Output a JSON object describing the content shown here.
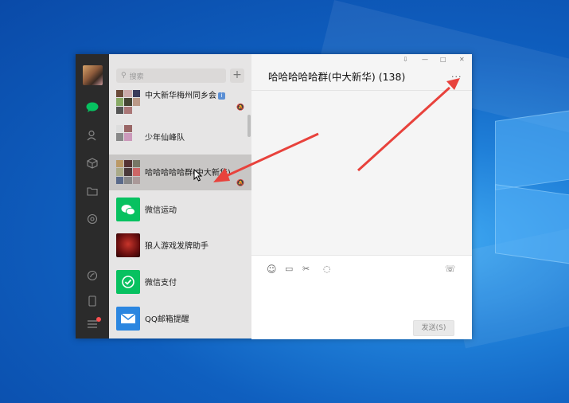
{
  "colors": {
    "accent_green": "#07c160",
    "arrow": "#e8423c",
    "nav_bg": "#2b2b2b",
    "list_bg": "#e6e5e5",
    "selected_bg": "#c8c6c5"
  },
  "search": {
    "placeholder": "搜索",
    "icon": "search-icon"
  },
  "nav": {
    "icons": [
      "chat-icon",
      "contacts-icon",
      "favorites-icon",
      "files-icon",
      "moments-icon",
      "mini-programs-icon",
      "phone-icon",
      "menu-icon"
    ]
  },
  "chats": [
    {
      "name": "中大新华梅州同乡会",
      "badge": "i",
      "muted": true
    },
    {
      "name": "少年仙峰队",
      "muted": false
    },
    {
      "name": "哈哈哈哈哈群(中大新华)",
      "muted": true,
      "selected": true
    },
    {
      "name": "微信运动",
      "muted": false
    },
    {
      "name": "狼人游戏发牌助手",
      "muted": false
    },
    {
      "name": "微信支付",
      "muted": false
    },
    {
      "name": "QQ邮箱提醒",
      "muted": false
    }
  ],
  "chat": {
    "title": "哈哈哈哈哈群(中大新华) (138)",
    "more": "···",
    "send_label": "发送(S)"
  },
  "window_controls": {
    "pin": "⇩",
    "minimize": "—",
    "maximize": "□",
    "close": "✕"
  },
  "toolbar": {
    "emoji": "☺",
    "file": "▭",
    "screenshot": "✂",
    "chat_history": "◌",
    "call": "☏"
  }
}
